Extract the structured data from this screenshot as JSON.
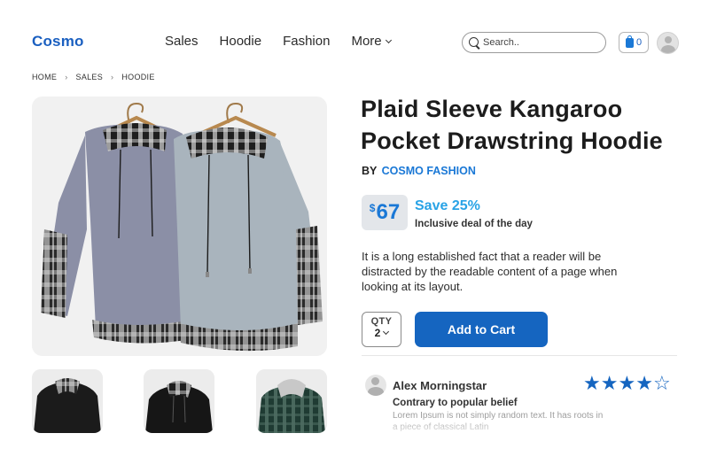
{
  "header": {
    "logo": "Cosmo",
    "nav": [
      {
        "label": "Sales"
      },
      {
        "label": "Hoodie"
      },
      {
        "label": "Fashion"
      },
      {
        "label": "More"
      }
    ],
    "search_placeholder": "Search..",
    "cart_count": "0"
  },
  "breadcrumb": [
    "HOME",
    "SALES",
    "HOODIE"
  ],
  "product": {
    "title": "Plaid Sleeve Kangaroo Pocket Drawstring Hoodie",
    "by_label": "BY",
    "brand": "COSMO FASHION",
    "currency": "$",
    "price": "67",
    "save": "Save 25%",
    "deal": "Inclusive deal of the day",
    "description": "It is a long established fact that a reader will be distracted by the readable content of a page when looking at its layout.",
    "qty_label": "QTY",
    "qty_value": "2",
    "add_to_cart": "Add to Cart"
  },
  "review": {
    "name": "Alex Morningstar",
    "rating": 4,
    "rating_max": 5,
    "title": "Contrary to popular belief",
    "body": "Lorem Ipsum is not simply random text. It has roots in a piece of classical Latin"
  },
  "colors": {
    "brand": "#1a5fc0",
    "accent": "#1565c0",
    "save": "#29a3e6"
  }
}
